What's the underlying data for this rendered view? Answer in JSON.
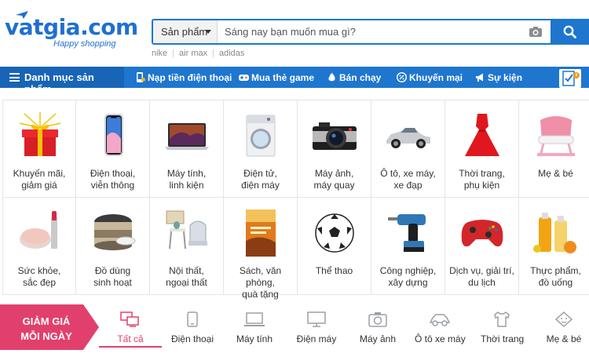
{
  "brand": {
    "logo_text": "vatgia.com",
    "tagline": "Happy shopping",
    "primary_color": "#1e76cf",
    "accent_color": "#e2406c"
  },
  "search": {
    "category_label": "Sản phẩm",
    "placeholder": "Sáng nay bạn muốn mua gì?",
    "camera_icon": "camera-icon",
    "submit_icon": "search-icon"
  },
  "hot_keywords": [
    "nike",
    "air max",
    "adidas"
  ],
  "nav": {
    "category_label": "Danh mục sản phẩm",
    "items": [
      {
        "label": "Nạp tiền điện thoại",
        "icon": "phone-topup-icon"
      },
      {
        "label": "Mua thẻ game",
        "icon": "game-card-icon"
      },
      {
        "label": "Bán chạy",
        "icon": "fire-icon"
      },
      {
        "label": "Khuyến mại",
        "icon": "percent-icon"
      },
      {
        "label": "Sự kiện",
        "icon": "megaphone-icon"
      }
    ],
    "cart_icon": "checklist-icon"
  },
  "categories": [
    {
      "line1": "Khuyến mãi,",
      "line2": "giảm giá",
      "icon": "gift-box-icon"
    },
    {
      "line1": "Điện thoại,",
      "line2": "viễn thông",
      "icon": "smartphone-icon"
    },
    {
      "line1": "Máy tính,",
      "line2": "linh kiện",
      "icon": "laptop-icon"
    },
    {
      "line1": "Điện tử,",
      "line2": "điện máy",
      "icon": "washing-machine-icon"
    },
    {
      "line1": "Máy ảnh,",
      "line2": "máy quay",
      "icon": "camera-product-icon"
    },
    {
      "line1": "Ô tô, xe máy,",
      "line2": "xe đạp",
      "icon": "car-icon"
    },
    {
      "line1": "Thời trang,",
      "line2": "phụ kiện",
      "icon": "dress-icon"
    },
    {
      "line1": "Mẹ & bé",
      "line2": "",
      "icon": "baby-chair-icon"
    },
    {
      "line1": "Sức khỏe,",
      "line2": "sắc đẹp",
      "icon": "cosmetics-icon"
    },
    {
      "line1": "Đồ dùng",
      "line2": "sinh hoạt",
      "icon": "rice-cooker-icon"
    },
    {
      "line1": "Nội thất,",
      "line2": "ngoại thất",
      "icon": "furniture-icon"
    },
    {
      "line1": "Sách, văn phòng,",
      "line2": "quà tặng",
      "icon": "book-icon"
    },
    {
      "line1": "Thể thao",
      "line2": "",
      "icon": "soccer-ball-icon"
    },
    {
      "line1": "Công nghiệp,",
      "line2": "xây dựng",
      "icon": "drill-icon"
    },
    {
      "line1": "Dịch vụ, giải trí,",
      "line2": "du lịch",
      "icon": "gamepad-icon"
    },
    {
      "line1": "Thực phẩm,",
      "line2": "đồ uống",
      "icon": "juice-icon"
    }
  ],
  "deals": {
    "badge_line1": "GIẢM GIÁ",
    "badge_line2": "MỖI NGÀY",
    "tabs": [
      {
        "label": "Tất cả",
        "icon": "all-monitors-icon",
        "active": true
      },
      {
        "label": "Điện thoại",
        "icon": "phone-outline-icon"
      },
      {
        "label": "Máy tính",
        "icon": "laptop-outline-icon"
      },
      {
        "label": "Điện máy",
        "icon": "tv-outline-icon"
      },
      {
        "label": "Máy ảnh",
        "icon": "camera-outline-icon"
      },
      {
        "label": "Ô tô xe máy",
        "icon": "car-outline-icon"
      },
      {
        "label": "Thời trang",
        "icon": "shirt-outline-icon"
      },
      {
        "label": "Mẹ & bé",
        "icon": "baby-outline-icon"
      }
    ]
  }
}
